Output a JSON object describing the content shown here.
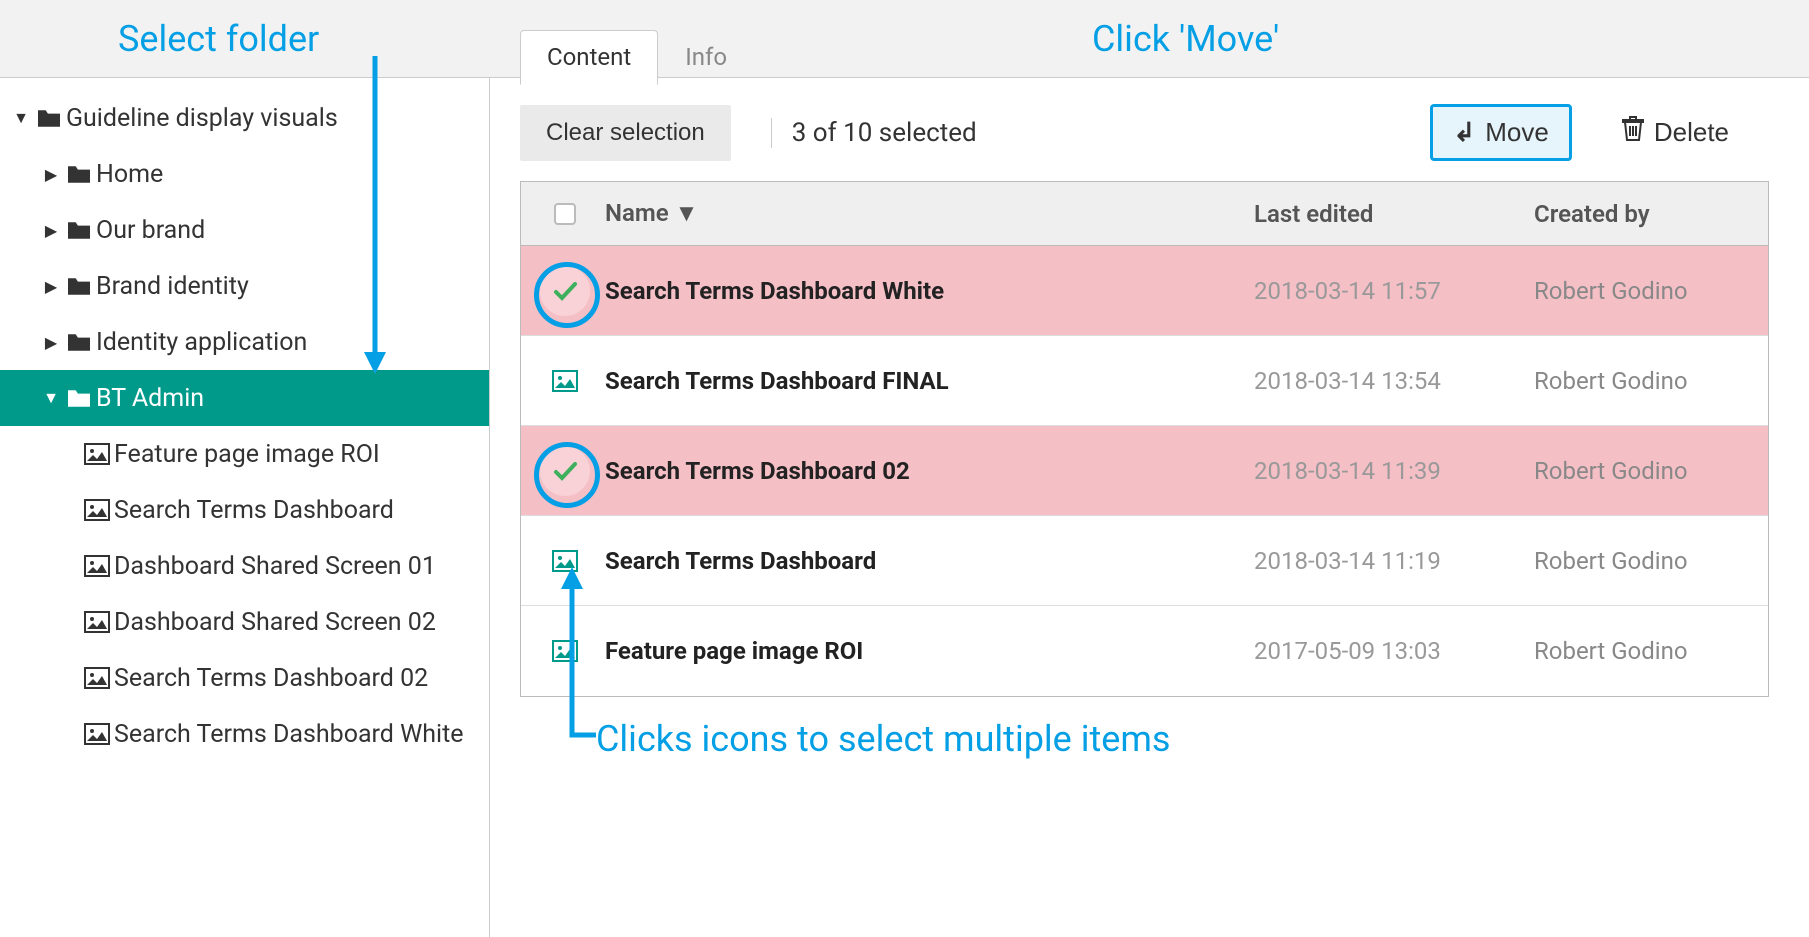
{
  "annotations": {
    "select_folder": "Select folder",
    "click_move": "Click 'Move'",
    "click_icons": "Clicks icons to select multiple items"
  },
  "sidebar": {
    "root": "Guideline display visuals",
    "items": [
      {
        "label": "Home"
      },
      {
        "label": "Our brand"
      },
      {
        "label": "Brand identity"
      },
      {
        "label": "Identity application"
      },
      {
        "label": "BT Admin",
        "active": true
      }
    ],
    "subitems": [
      {
        "label": "Feature page image ROI"
      },
      {
        "label": "Search Terms Dashboard"
      },
      {
        "label": "Dashboard Shared Screen 01"
      },
      {
        "label": "Dashboard Shared Screen 02"
      },
      {
        "label": "Search Terms Dashboard 02"
      },
      {
        "label": "Search Terms Dashboard White"
      }
    ]
  },
  "tabs": {
    "content": "Content",
    "info": "Info"
  },
  "toolbar": {
    "clear": "Clear selection",
    "selection": "3 of 10 selected",
    "move": "Move",
    "delete": "Delete"
  },
  "table": {
    "headers": {
      "name": "Name",
      "date": "Last edited",
      "author": "Created by"
    },
    "rows": [
      {
        "name": "Search Terms Dashboard White",
        "date": "2018-03-14 11:57",
        "author": "Robert Godino",
        "selected": true
      },
      {
        "name": "Search Terms Dashboard FINAL",
        "date": "2018-03-14 13:54",
        "author": "Robert Godino",
        "selected": false
      },
      {
        "name": "Search Terms Dashboard 02",
        "date": "2018-03-14 11:39",
        "author": "Robert Godino",
        "selected": true
      },
      {
        "name": "Search Terms Dashboard",
        "date": "2018-03-14 11:19",
        "author": "Robert Godino",
        "selected": false
      },
      {
        "name": "Feature page image ROI",
        "date": "2017-05-09 13:03",
        "author": "Robert Godino",
        "selected": false
      }
    ]
  }
}
